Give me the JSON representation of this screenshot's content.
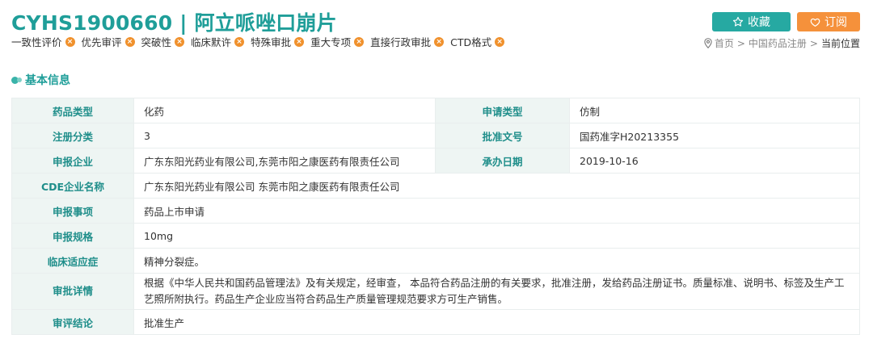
{
  "header": {
    "title": "CYHS1900660 | 阿立哌唑口崩片",
    "tags": [
      "一致性评价",
      "优先审评",
      "突破性",
      "临床默许",
      "特殊审批",
      "重大专项",
      "直接行政审批",
      "CTD格式"
    ],
    "tag_remove_glyph": "×",
    "favorite_label": "收藏",
    "subscribe_label": "订阅"
  },
  "breadcrumb": {
    "home": "首页",
    "section": "中国药品注册",
    "current": "当前位置",
    "separator": ">"
  },
  "section": {
    "title": "基本信息"
  },
  "info": {
    "drug_type_label": "药品类型",
    "drug_type": "化药",
    "apply_type_label": "申请类型",
    "apply_type": "仿制",
    "reg_class_label": "注册分类",
    "reg_class": "3",
    "approval_no_label": "批准文号",
    "approval_no": "国药准字H20213355",
    "applicant_label": "申报企业",
    "applicant": "广东东阳光药业有限公司,东莞市阳之康医药有限责任公司",
    "accept_date_label": "承办日期",
    "accept_date": "2019-10-16",
    "cde_company_label": "CDE企业名称",
    "cde_company": "广东东阳光药业有限公司 东莞市阳之康医药有限责任公司",
    "apply_item_label": "申报事项",
    "apply_item": "药品上市申请",
    "spec_label": "申报规格",
    "spec": "10mg",
    "indication_label": "临床适应症",
    "indication": "精神分裂症。",
    "approval_detail_label": "审批详情",
    "approval_detail": "根据《中华人民共和国药品管理法》及有关规定，经审查， 本品符合药品注册的有关要求，批准注册，发给药品注册证书。质量标准、说明书、标签及生产工艺照所附执行。药品生产企业应当符合药品生产质量管理规范要求方可生产销售。",
    "conclusion_label": "审评结论",
    "conclusion": "批准生产"
  },
  "colors": {
    "title": "#1f9e99",
    "favorite_button": "#26a9a2",
    "subscribe_button": "#f5913b",
    "tag_remove": "#f0912d",
    "label_bg": "#eef5f3"
  },
  "icons": {
    "favorite": "star-icon",
    "subscribe": "heart-icon",
    "breadcrumb": "location-pin-icon",
    "tag_remove": "close-circle-icon"
  }
}
